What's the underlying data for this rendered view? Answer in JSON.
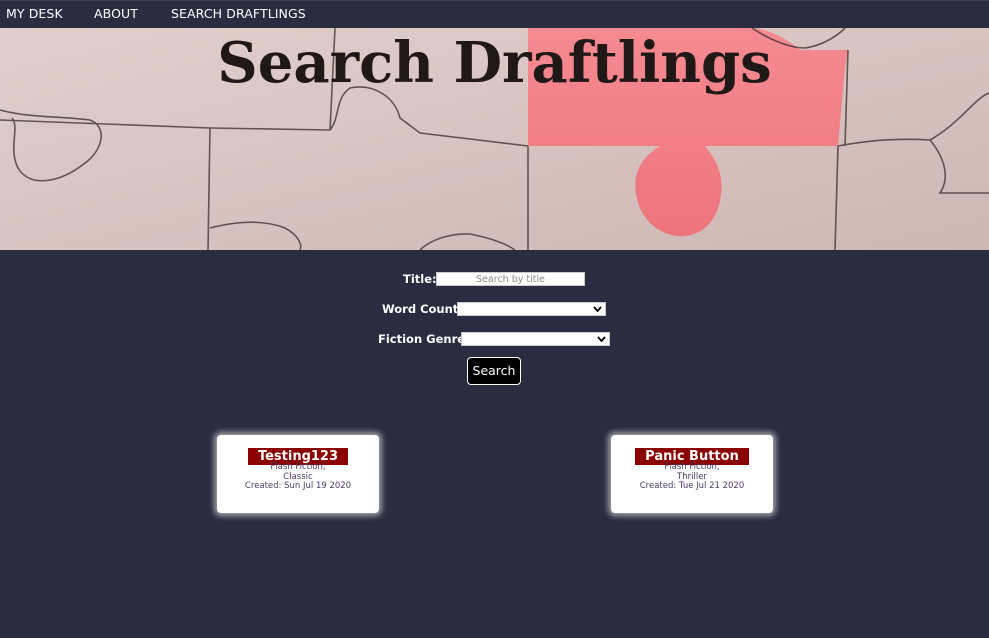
{
  "nav": {
    "items": [
      "MY DESK",
      "ABOUT",
      "SEARCH DRAFTLINGS"
    ]
  },
  "hero": {
    "title": "Search Draftlings"
  },
  "search_form": {
    "title_label": "Title:",
    "title_placeholder": "Search by title",
    "title_value": "",
    "word_count_label": "Word Count:",
    "word_count_value": "",
    "genre_label": "Fiction Genre",
    "genre_value": "",
    "search_button": "Search"
  },
  "results": [
    {
      "title": "Testing123",
      "genre_line1": "Flash Fiction,",
      "genre_line2": "Classic",
      "created": "Created: Sun Jul 19 2020"
    },
    {
      "title": "Panic Button",
      "genre_line1": "Flash Fiction,",
      "genre_line2": "Thriller",
      "created": "Created: Tue Jul 21 2020"
    }
  ],
  "colors": {
    "background": "#2a2c40",
    "card_title_bg": "#8b0000",
    "puzzle_highlight": "#f07f86"
  }
}
